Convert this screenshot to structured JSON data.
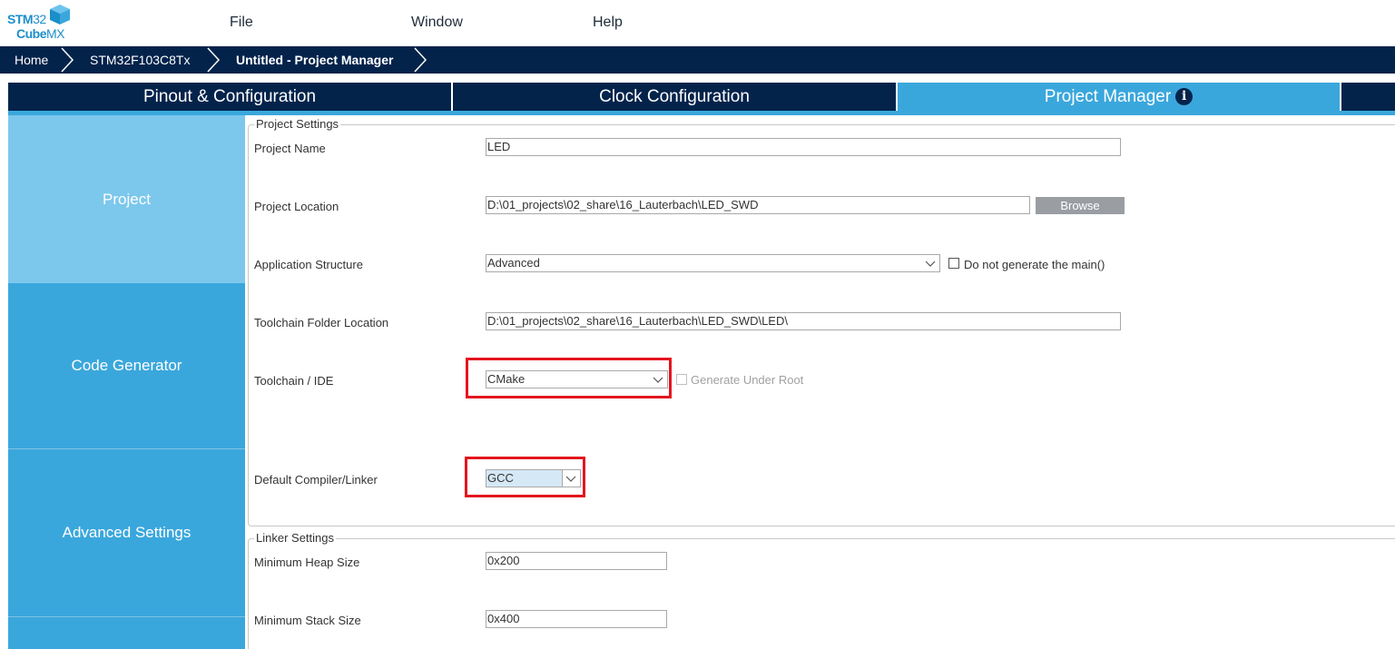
{
  "app": {
    "logo_line1_bold": "STM",
    "logo_line1_thin": "32",
    "logo_line2_bold": "Cube",
    "logo_line2_thin": "MX"
  },
  "menu": {
    "file": "File",
    "window": "Window",
    "help": "Help"
  },
  "breadcrumb": {
    "home": "Home",
    "device": "STM32F103C8Tx",
    "project": "Untitled - Project Manager"
  },
  "tabs": {
    "pinout": "Pinout & Configuration",
    "clock": "Clock Configuration",
    "project_manager": "Project Manager",
    "info_glyph": "i"
  },
  "sidenav": {
    "project": "Project",
    "code_generator": "Code Generator",
    "advanced": "Advanced Settings"
  },
  "project_settings": {
    "legend": "Project Settings",
    "name_label": "Project Name",
    "name_value": "LED",
    "location_label": "Project Location",
    "location_value": "D:\\01_projects\\02_share\\16_Lauterbach\\LED_SWD",
    "browse_label": "Browse",
    "app_structure_label": "Application Structure",
    "app_structure_value": "Advanced",
    "no_main_label": "Do not generate the main()",
    "toolchain_folder_label": "Toolchain Folder Location",
    "toolchain_folder_value": "D:\\01_projects\\02_share\\16_Lauterbach\\LED_SWD\\LED\\",
    "toolchain_ide_label": "Toolchain / IDE",
    "toolchain_ide_value": "CMake",
    "generate_under_root_label": "Generate Under Root",
    "compiler_label": "Default Compiler/Linker",
    "compiler_value": "GCC"
  },
  "linker_settings": {
    "legend": "Linker Settings",
    "heap_label": "Minimum Heap Size",
    "heap_value": "0x200",
    "stack_label": "Minimum Stack Size",
    "stack_value": "0x400"
  },
  "colors": {
    "navy": "#03234b",
    "accent_blue": "#3aa7dc",
    "active_side": "#7cc8ec",
    "highlight_red": "#e3161e"
  }
}
